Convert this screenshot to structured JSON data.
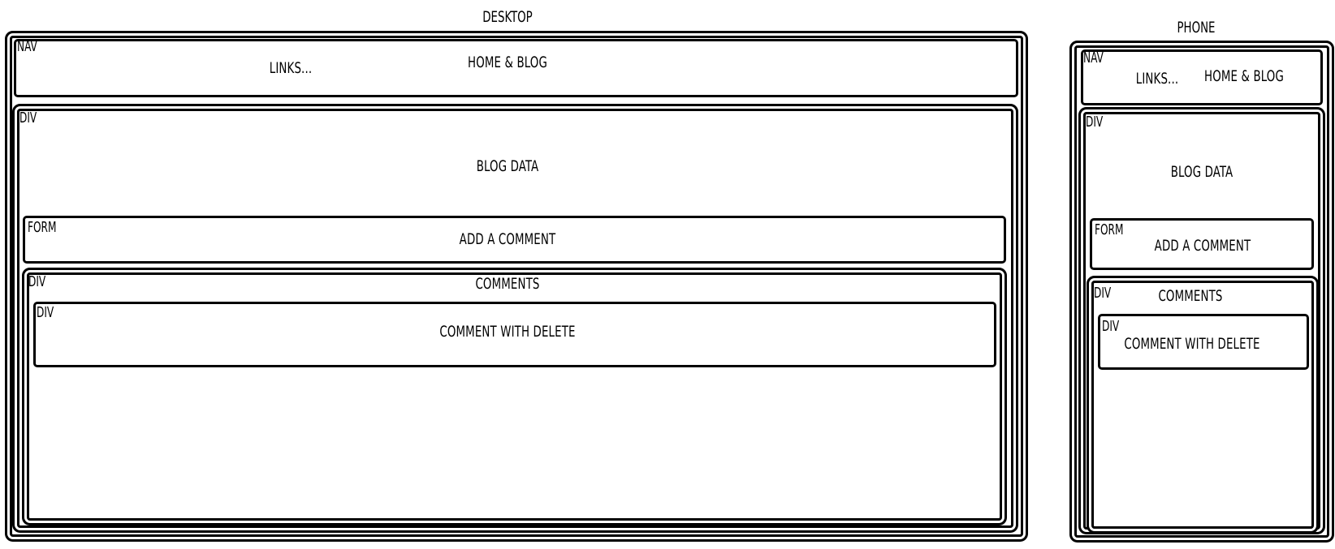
{
  "desktop": {
    "title": "DESKTOP",
    "nav": {
      "tag": "NAV",
      "links": "LINKS...",
      "home": "HOME & BLOG"
    },
    "main": {
      "tag": "DIV",
      "label": "BLOG DATA"
    },
    "form": {
      "tag": "FORM",
      "label": "ADD A COMMENT"
    },
    "comments": {
      "tag": "DIV",
      "label": "COMMENTS"
    },
    "comment": {
      "tag": "DIV",
      "label": "COMMENT WITH DELETE"
    }
  },
  "phone": {
    "title": "PHONE",
    "nav": {
      "tag": "NAV",
      "links": "LINKS...",
      "home": "HOME & BLOG"
    },
    "main": {
      "tag": "DIV",
      "label": "BLOG DATA"
    },
    "form": {
      "tag": "FORM",
      "label": "ADD A COMMENT"
    },
    "comments": {
      "tag": "DIV",
      "label": "COMMENTS"
    },
    "comment": {
      "tag": "DIV",
      "label": "COMMENT WITH DELETE"
    }
  }
}
